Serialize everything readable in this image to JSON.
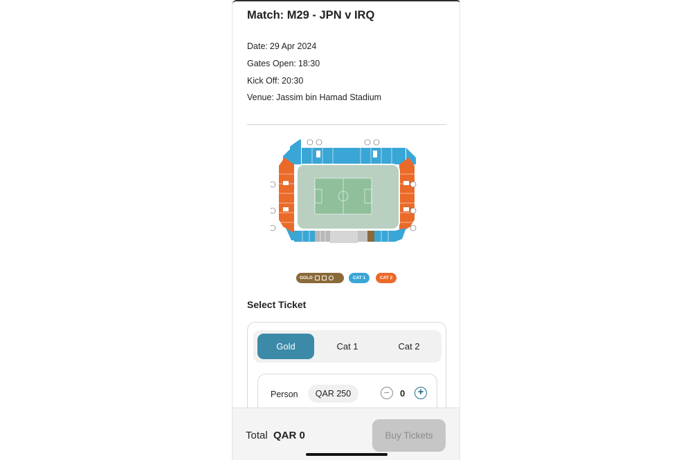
{
  "match": {
    "title": "Match: M29 - JPN v IRQ",
    "date_label": "Date:",
    "date_value": "29 Apr 2024",
    "gates_label": "Gates Open:",
    "gates_value": "18:30",
    "kickoff_label": "Kick Off:",
    "kickoff_value": "20:30",
    "venue_label": "Venue:",
    "venue_value": "Jassim bin Hamad Stadium"
  },
  "legend": {
    "gold": "GOLD",
    "cat1": "CAT 1",
    "cat2": "CAT 2",
    "gold_color": "#8a6a3a",
    "cat1_color": "#3aa6d6",
    "cat2_color": "#ea6a2a"
  },
  "select_ticket": {
    "title": "Select Ticket",
    "tabs": [
      "Gold",
      "Cat 1",
      "Cat 2"
    ],
    "active_tab": "Gold",
    "row": {
      "label": "Person",
      "price": "QAR 250",
      "quantity": "0"
    }
  },
  "footer": {
    "total_label": "Total",
    "total_value": "QAR 0",
    "buy_label": "Buy Tickets"
  },
  "colors": {
    "accent": "#3b8aa8",
    "plus_icon": "#1f6f8b"
  }
}
